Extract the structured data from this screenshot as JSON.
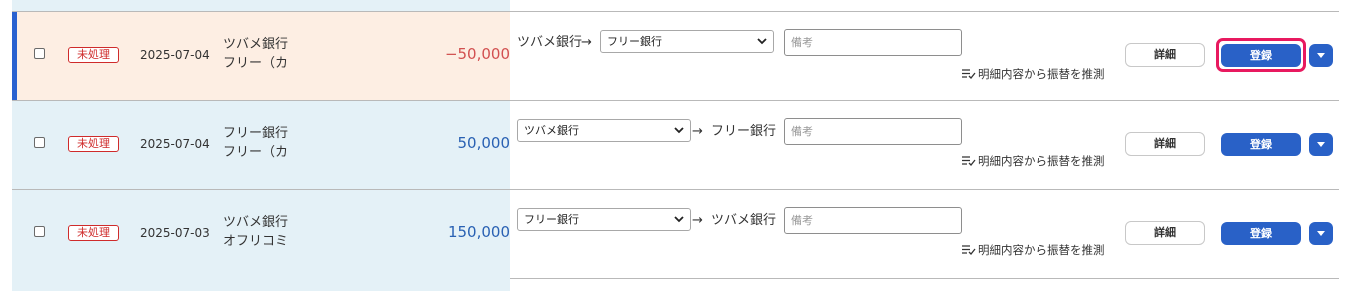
{
  "rows": [
    {
      "status": "未処理",
      "date": "2025-07-04",
      "desc_line1": "ツバメ銀行",
      "desc_line2": "フリー（カ",
      "amount": "−50,000",
      "amount_sign": "negative",
      "from_account": "ツバメ銀行",
      "arrow": "→",
      "to_account": "フリー銀行",
      "memo_placeholder": "備考",
      "infer_label": "明細内容から振替を推測",
      "detail_label": "詳細",
      "register_label": "登録",
      "focused": true
    },
    {
      "status": "未処理",
      "date": "2025-07-04",
      "desc_line1": "フリー銀行",
      "desc_line2": "フリー（カ",
      "amount": "50,000",
      "amount_sign": "positive",
      "from_account": "ツバメ銀行",
      "arrow": "→",
      "to_account": "フリー銀行",
      "memo_placeholder": "備考",
      "infer_label": "明細内容から振替を推測",
      "detail_label": "詳細",
      "register_label": "登録",
      "focused": false
    },
    {
      "status": "未処理",
      "date": "2025-07-03",
      "desc_line1": "ツバメ銀行",
      "desc_line2": "オフリコミ",
      "amount": "150,000",
      "amount_sign": "positive",
      "from_account": "フリー銀行",
      "arrow": "→",
      "to_account": "ツバメ銀行",
      "memo_placeholder": "備考",
      "infer_label": "明細内容から振替を推測",
      "detail_label": "詳細",
      "register_label": "登録",
      "focused": false
    }
  ],
  "icons": {
    "dropdown": "chevron-down-icon",
    "infer": "list-check-icon",
    "menu": "caret-down-icon"
  },
  "colors": {
    "accent_blue": "#2961c7",
    "negative_amount": "#d25050",
    "positive_amount": "#2961b3",
    "status_red": "#cf2b2b",
    "focus_pink": "#e8195f",
    "active_row_bg": "#fdeee3",
    "row_bg": "#e4f1f7"
  }
}
